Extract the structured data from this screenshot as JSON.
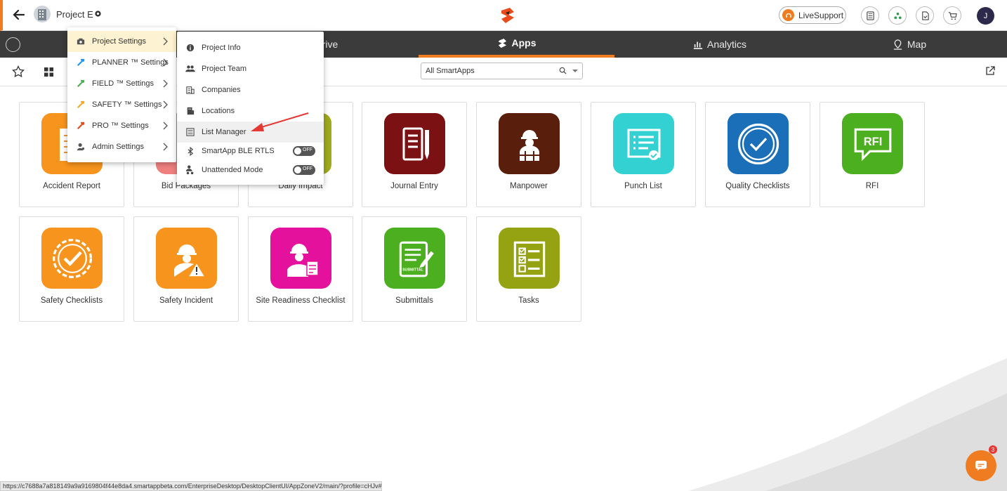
{
  "header": {
    "project_title": "Project E",
    "live_support": "LiveSupport",
    "user_initial": "J"
  },
  "nav": {
    "tabs": [
      {
        "label": "rive",
        "active": false
      },
      {
        "label": "Apps",
        "active": true
      },
      {
        "label": "Analytics",
        "active": false
      },
      {
        "label": "Map",
        "active": false
      }
    ]
  },
  "toolbar": {
    "filter_value": "All SmartApps"
  },
  "settings_menu": {
    "items": [
      {
        "label": "Project Settings",
        "icon": "camera-icon",
        "color": "#555555"
      },
      {
        "label": "PLANNER ™ Settings",
        "icon": "hammer-icon",
        "color": "#2196f3"
      },
      {
        "label": "FIELD ™ Settings",
        "icon": "hammer-icon",
        "color": "#4caf50"
      },
      {
        "label": "SAFETY ™ Settings",
        "icon": "hammer-icon",
        "color": "#f9a825"
      },
      {
        "label": "PRO ™ Settings",
        "icon": "hammer-icon",
        "color": "#e64a19"
      },
      {
        "label": "Admin Settings",
        "icon": "admin-icon",
        "color": "#555555"
      }
    ]
  },
  "project_submenu": {
    "items": [
      {
        "label": "Project Info",
        "icon": "info-icon"
      },
      {
        "label": "Project Team",
        "icon": "team-icon"
      },
      {
        "label": "Companies",
        "icon": "building-icon"
      },
      {
        "label": "Locations",
        "icon": "location-icon"
      },
      {
        "label": "List Manager",
        "icon": "list-icon"
      },
      {
        "label": "SmartApp BLE RTLS",
        "icon": "bluetooth-icon",
        "toggle": "OFF"
      },
      {
        "label": "Unattended Mode",
        "icon": "unattended-icon",
        "toggle": "OFF"
      }
    ]
  },
  "apps": [
    {
      "label": "Accident Report",
      "color": "#f7941d"
    },
    {
      "label": "Bid Packages",
      "color": "#f08080"
    },
    {
      "label": "Daily Impact",
      "color": "#a0a91c"
    },
    {
      "label": "Journal Entry",
      "color": "#7b1113"
    },
    {
      "label": "Manpower",
      "color": "#5a1f0c"
    },
    {
      "label": "Punch List",
      "color": "#33d1d1"
    },
    {
      "label": "Quality Checklists",
      "color": "#1a6fb8"
    },
    {
      "label": "RFI",
      "color": "#4caf1f",
      "badge_text": "RFI"
    },
    {
      "label": "Safety Checklists",
      "color": "#f7941d"
    },
    {
      "label": "Safety Incident",
      "color": "#f7941d"
    },
    {
      "label": "Site Readiness Checklist",
      "color": "#e3119b"
    },
    {
      "label": "Submittals",
      "color": "#4caf1f",
      "badge_text": "SUBMITTAL"
    },
    {
      "label": "Tasks",
      "color": "#95a212"
    }
  ],
  "status_url": "https://c7688a7a818149a9a9169804f44e8da4.smartappbeta.com/EnterpriseDesktop/DesktopClientUI/AppZoneV2/main/?profile=cHJv#",
  "chat_badge": "3"
}
